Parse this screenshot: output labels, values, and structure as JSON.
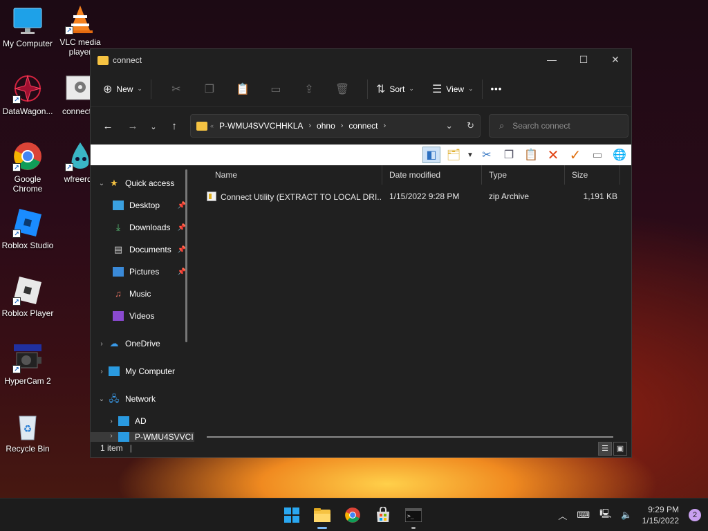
{
  "desktop": {
    "icons": [
      {
        "label": "My Computer",
        "icon": "monitor-icon"
      },
      {
        "label": "VLC media player",
        "icon": "vlc-cone-icon"
      },
      {
        "label": "DataWagon...",
        "icon": "datawagon-icon"
      },
      {
        "label": "connect...",
        "icon": "connect-settings-icon"
      },
      {
        "label": "Google Chrome",
        "icon": "chrome-icon"
      },
      {
        "label": "wfreerdp",
        "icon": "wfreerdp-icon"
      },
      {
        "label": "Roblox Studio",
        "icon": "roblox-studio-icon"
      },
      {
        "label": "Roblox Player",
        "icon": "roblox-player-icon"
      },
      {
        "label": "HyperCam 2",
        "icon": "hypercam-icon"
      },
      {
        "label": "Recycle Bin",
        "icon": "recycle-bin-icon"
      }
    ],
    "vlc_label_line2": "player",
    "roblox_label_line2": ""
  },
  "window": {
    "title": "connect",
    "minimize": "—",
    "maximize": "☐",
    "close": "✕"
  },
  "toolbar": {
    "new_label": "New",
    "sort_label": "Sort",
    "view_label": "View",
    "more_label": "•••"
  },
  "address": {
    "prefix": "«",
    "crumbs": [
      "P-WMU4SVVCHHKLA",
      "ohno",
      "connect"
    ],
    "search_placeholder": "Search connect"
  },
  "nav": {
    "items": [
      {
        "label": "Quick access",
        "icon": "star-icon"
      },
      {
        "label": "Desktop",
        "icon": "desktop-icon"
      },
      {
        "label": "Downloads",
        "icon": "download-icon"
      },
      {
        "label": "Documents",
        "icon": "document-icon"
      },
      {
        "label": "Pictures",
        "icon": "pictures-icon"
      },
      {
        "label": "Music",
        "icon": "music-icon"
      },
      {
        "label": "Videos",
        "icon": "videos-icon"
      },
      {
        "label": "OneDrive",
        "icon": "cloud-icon"
      },
      {
        "label": "My Computer",
        "icon": "monitor-icon"
      },
      {
        "label": "Network",
        "icon": "network-icon"
      },
      {
        "label": "AD",
        "icon": "monitor-icon"
      },
      {
        "label": "P-WMU4SVVCI",
        "icon": "monitor-icon"
      }
    ]
  },
  "columns": [
    "Name",
    "Date modified",
    "Type",
    "Size"
  ],
  "files": [
    {
      "name": "Connect Utility (EXTRACT TO LOCAL DRI...",
      "date": "1/15/2022 9:28 PM",
      "type": "zip Archive",
      "size": "1,191 KB"
    }
  ],
  "status": {
    "count": "1 item",
    "caret": "|"
  },
  "taskbar": {
    "time": "9:29 PM",
    "date": "1/15/2022",
    "notifications": "2",
    "apps": [
      "windows-start-icon",
      "file-explorer-icon",
      "chrome-icon",
      "store-icon",
      "terminal-icon"
    ]
  },
  "colors": {
    "folder": "#f6c342",
    "accent_blue": "#0078d4",
    "window_bg": "#202020"
  }
}
